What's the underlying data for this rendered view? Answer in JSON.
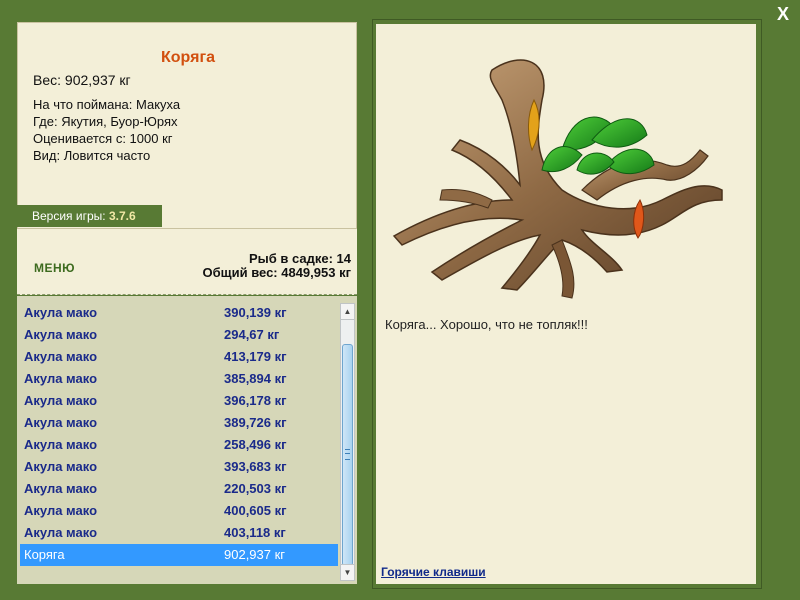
{
  "header": {
    "close_label": "X"
  },
  "fish": {
    "title": "Коряга",
    "weight": "Вес: 902,937 кг",
    "caught_on": "На что поймана: Макуха",
    "location": "Где: Якутия, Буор-Юрях",
    "valued_from": "Оценивается с: 1000 кг",
    "species": "Вид: Ловится часто"
  },
  "version": {
    "label": "Версия игры:",
    "value": "3.7.6"
  },
  "menu": {
    "label": "МЕНЮ"
  },
  "creel": {
    "count": "Рыб в садке: 14",
    "total_weight": "Общий вес: 4849,953 кг"
  },
  "catch_list": [
    {
      "name": "Акула мако",
      "weight": "390,139 кг"
    },
    {
      "name": "Акула мако",
      "weight": "294,67 кг"
    },
    {
      "name": "Акула мако",
      "weight": "413,179 кг"
    },
    {
      "name": "Акула мако",
      "weight": "385,894 кг"
    },
    {
      "name": "Акула мако",
      "weight": "396,178 кг"
    },
    {
      "name": "Акула мако",
      "weight": "389,726 кг"
    },
    {
      "name": "Акула мако",
      "weight": "258,496 кг"
    },
    {
      "name": "Акула мако",
      "weight": "393,683 кг"
    },
    {
      "name": "Акула мако",
      "weight": "220,503 кг"
    },
    {
      "name": "Акула мако",
      "weight": "400,605 кг"
    },
    {
      "name": "Акула мако",
      "weight": "403,118 кг"
    },
    {
      "name": "Коряга",
      "weight": "902,937 кг",
      "selected": true
    }
  ],
  "message": "Коряга... Хорошо, что не топляк!!!",
  "hotkeys": {
    "label": "Горячие клавиши"
  },
  "colors": {
    "frame_green": "#587a34",
    "panel_cream": "#f3efd8",
    "list_bg": "#d6d7b8",
    "title_orange": "#d2500f",
    "list_text": "#1a2a8a",
    "selected_row": "#3399ff"
  }
}
